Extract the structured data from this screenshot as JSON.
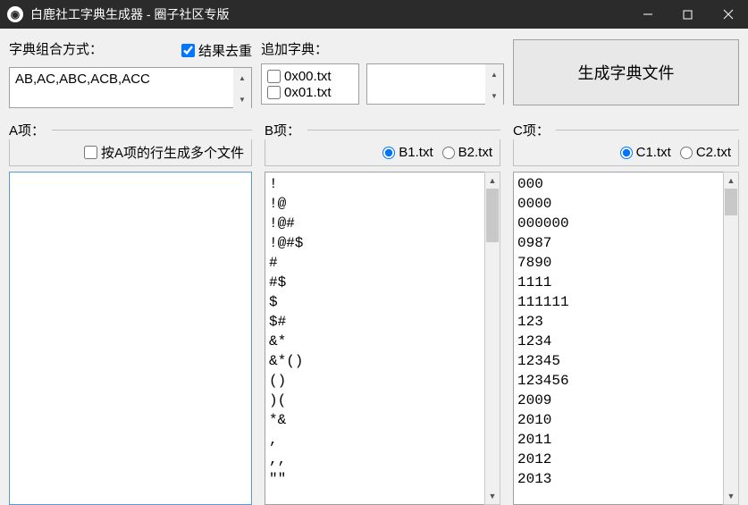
{
  "window": {
    "title": "白鹿社工字典生成器 - 圈子社区专版"
  },
  "top": {
    "combo_label": "字典组合方式：",
    "dedupe_label": "结果去重",
    "combo_value": "AB,AC,ABC,ACB,ACC",
    "append_label": "追加字典：",
    "append_check1": "0x00.txt",
    "append_check2": "0x01.txt",
    "generate_label": "生成字典文件"
  },
  "colA": {
    "title": "A项：",
    "sub_checkbox": "按A项的行生成多个文件"
  },
  "colB": {
    "title": "B项：",
    "radio1": "B1.txt",
    "radio2": "B2.txt",
    "items": "!\n!@\n!@#\n!@#$\n#\n#$\n$\n$#\n&*\n&*()\n()\n)(\n*&\n,\n,,\n\"\""
  },
  "colC": {
    "title": "C项：",
    "radio1": "C1.txt",
    "radio2": "C2.txt",
    "items": "000\n0000\n000000\n0987\n7890\n1111\n111111\n123\n1234\n12345\n123456\n2009\n2010\n2011\n2012\n2013"
  }
}
